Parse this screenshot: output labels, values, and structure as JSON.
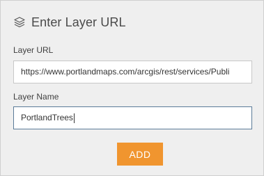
{
  "header": {
    "icon": "layers-icon",
    "title": "Enter Layer URL"
  },
  "form": {
    "url_label": "Layer URL",
    "url_value": "https://www.portlandmaps.com/arcgis/rest/services/Publi",
    "name_label": "Layer Name",
    "name_value": "PortlandTrees"
  },
  "actions": {
    "add_label": "ADD"
  },
  "colors": {
    "panel_bg": "#efefef",
    "accent": "#f0952f",
    "focused_border": "#5b7b98"
  }
}
